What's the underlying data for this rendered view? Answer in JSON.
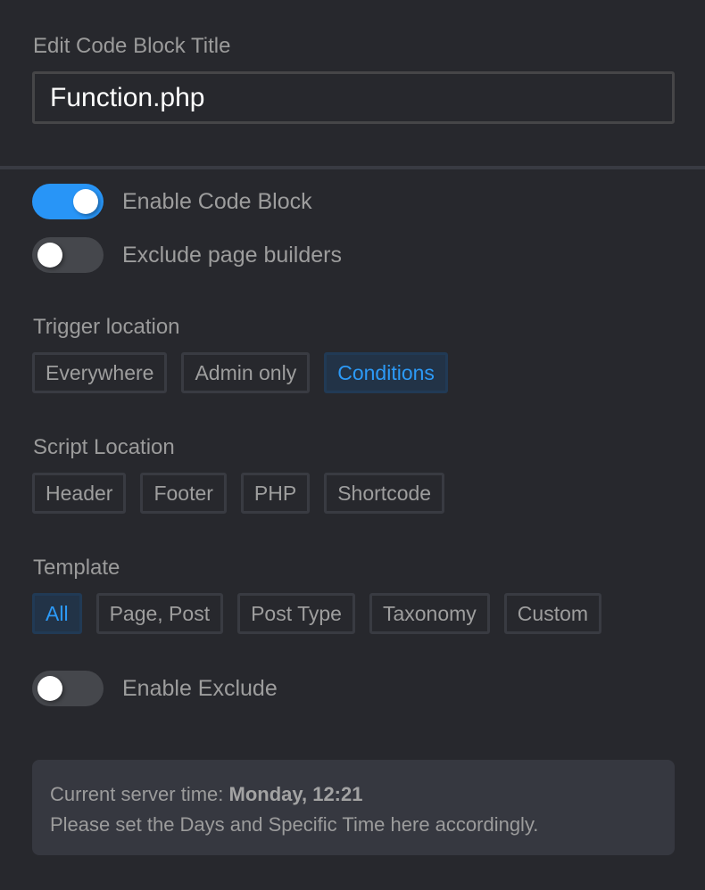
{
  "title_section": {
    "label": "Edit Code Block Title",
    "input_value": "Function.php"
  },
  "toggles": {
    "enable_code_block": {
      "label": "Enable Code Block",
      "state": "on"
    },
    "exclude_page_builders": {
      "label": "Exclude page builders",
      "state": "off"
    },
    "enable_exclude": {
      "label": "Enable Exclude",
      "state": "off"
    }
  },
  "trigger_location": {
    "label": "Trigger location",
    "options": [
      "Everywhere",
      "Admin only",
      "Conditions"
    ],
    "selected": "Conditions"
  },
  "script_location": {
    "label": "Script Location",
    "options": [
      "Header",
      "Footer",
      "PHP",
      "Shortcode"
    ],
    "selected": null
  },
  "template": {
    "label": "Template",
    "options": [
      "All",
      "Page, Post",
      "Post Type",
      "Taxonomy",
      "Custom"
    ],
    "selected": "All"
  },
  "info": {
    "server_time_prefix": "Current server time: ",
    "server_time_value": "Monday, 12:21",
    "hint": "Please set the Days and Specific Time here accordingly."
  },
  "colors": {
    "accent": "#2895f7",
    "background": "#27282d",
    "active_option_bg": "#223347"
  }
}
